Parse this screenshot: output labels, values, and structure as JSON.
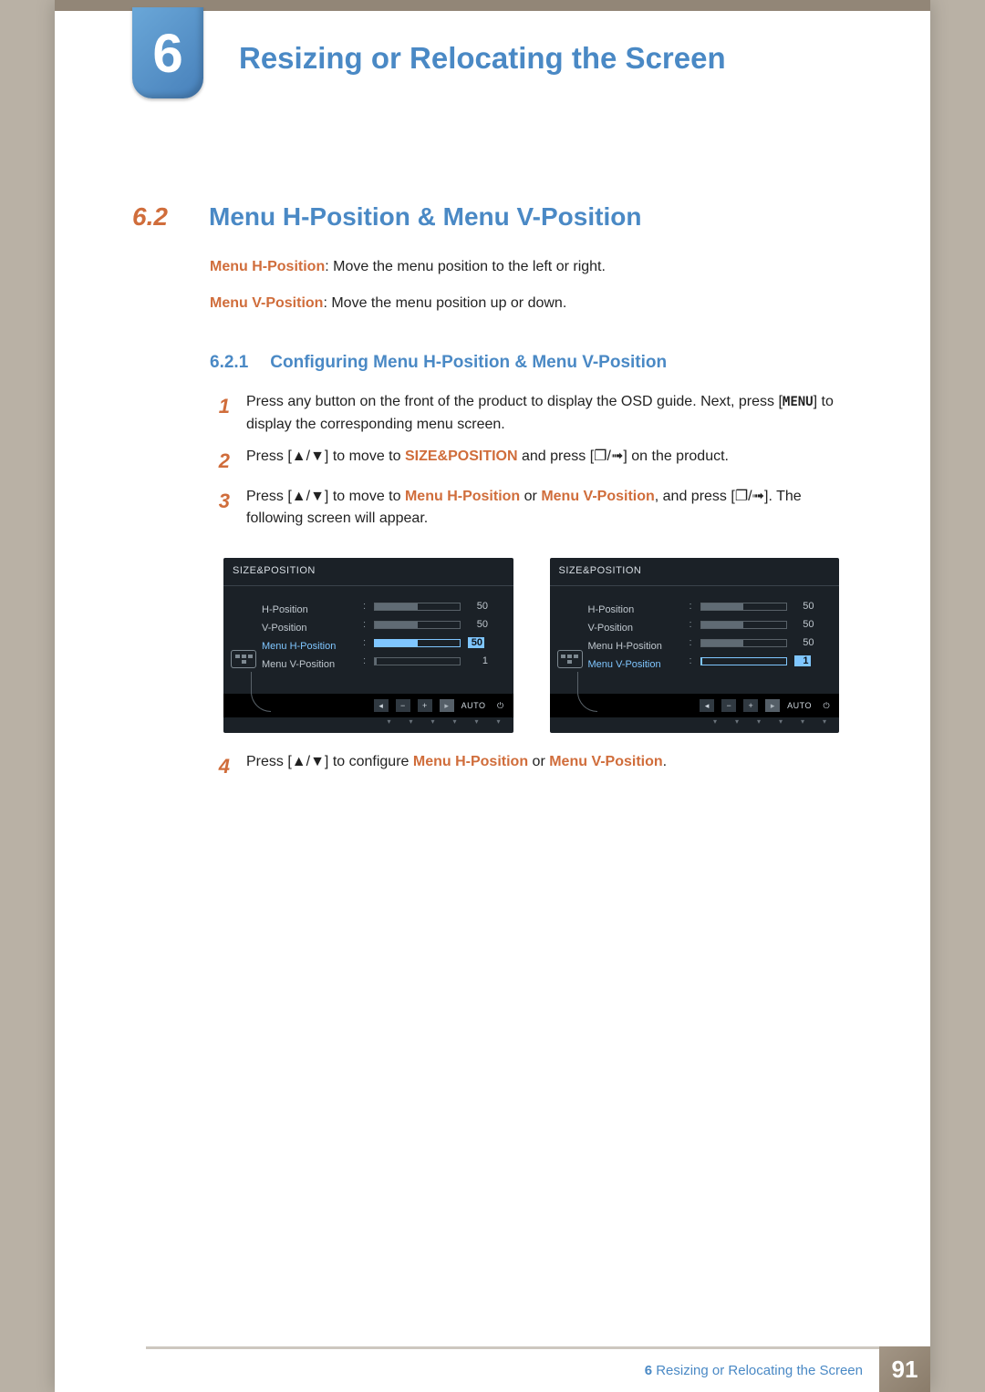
{
  "header": {
    "chapter_number": "6",
    "chapter_title": "Resizing or Relocating the Screen"
  },
  "section": {
    "number": "6.2",
    "title": "Menu H-Position & Menu V-Position"
  },
  "desc": {
    "hpos_label": "Menu H-Position",
    "hpos_text": ": Move the menu position to the left or right.",
    "vpos_label": "Menu V-Position",
    "vpos_text": ": Move the menu position up or down."
  },
  "subsection": {
    "number": "6.2.1",
    "title": "Configuring Menu H-Position & Menu V-Position"
  },
  "steps": {
    "s1": {
      "n": "1",
      "pre": "Press any button on the front of the product to display the OSD guide. Next, press [",
      "key": "MENU",
      "post": "] to display the corresponding menu screen."
    },
    "s2": {
      "n": "2",
      "pre": "Press [",
      "sym1": "▲/▼",
      "mid1": "] to move to ",
      "hl": "SIZE&POSITION",
      "mid2": " and press [",
      "sym2": "❐/➟",
      "post": "] on the product."
    },
    "s3": {
      "n": "3",
      "pre": "Press [",
      "sym1": "▲/▼",
      "mid1": "] to move to ",
      "hl1": "Menu H-Position",
      "or": " or ",
      "hl2": "Menu V-Position",
      "mid2": ", and press [",
      "sym2": "❐/➟",
      "post": "]. The following screen will appear."
    },
    "s4": {
      "n": "4",
      "pre": "Press [",
      "sym1": "▲/▼",
      "mid1": "] to configure ",
      "hl1": "Menu H-Position",
      "or": " or ",
      "hl2": "Menu V-Position",
      "post": "."
    }
  },
  "osd": {
    "title": "SIZE&POSITION",
    "rows": {
      "hpos": "H-Position",
      "vpos": "V-Position",
      "mhpos": "Menu H-Position",
      "mvpos": "Menu V-Position"
    },
    "left": {
      "selected": "mhpos",
      "values": {
        "hpos": "50",
        "vpos": "50",
        "mhpos": "50",
        "mvpos": "1"
      },
      "fills": {
        "hpos": 50,
        "vpos": 50,
        "mhpos": 50,
        "mvpos": 2
      }
    },
    "right": {
      "selected": "mvpos",
      "values": {
        "hpos": "50",
        "vpos": "50",
        "mhpos": "50",
        "mvpos": "1"
      },
      "fills": {
        "hpos": 50,
        "vpos": 50,
        "mhpos": 50,
        "mvpos": 2
      }
    },
    "footer": {
      "auto": "AUTO"
    }
  },
  "footer": {
    "label_prefix": "6 ",
    "label": "Resizing or Relocating the Screen",
    "page": "91"
  }
}
